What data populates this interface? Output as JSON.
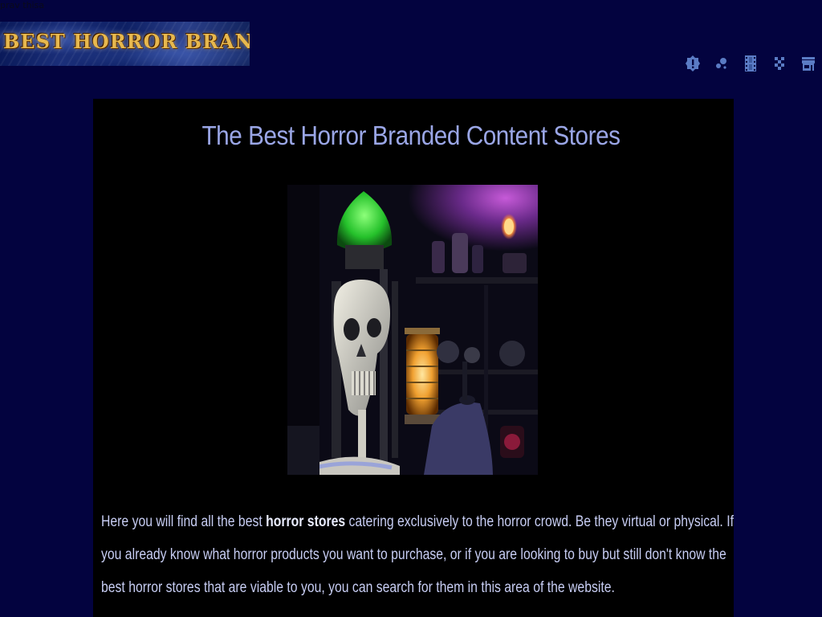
{
  "top_label": "prav thisa",
  "logo": {
    "text": "Best Horror Branded Content"
  },
  "nav": {
    "icons": [
      "alert-badge-icon",
      "location-dots-icon",
      "film-strip-icon",
      "checker-icon",
      "store-icon"
    ],
    "icon_color": "#5a7bc4"
  },
  "main": {
    "title": "The Best Horror Branded Content Stores",
    "hero_image": "skeleton-lantern-shop-icon",
    "text_before": "Here you will find all the best ",
    "text_bold": "horror stores",
    "text_after": " catering exclusively to the horror crowd. Be they virtual or physical. If you already know what horror products you want to purchase, or if you are looking to buy but still don't know the best horror stores that are viable to you, you can search for them in this area of the website."
  },
  "colors": {
    "page_background": "#03033f",
    "content_background": "#000000",
    "title_color": "#9aa6e6",
    "text_color": "#c7cdf3",
    "logo_text_color": "#e7b84e"
  }
}
